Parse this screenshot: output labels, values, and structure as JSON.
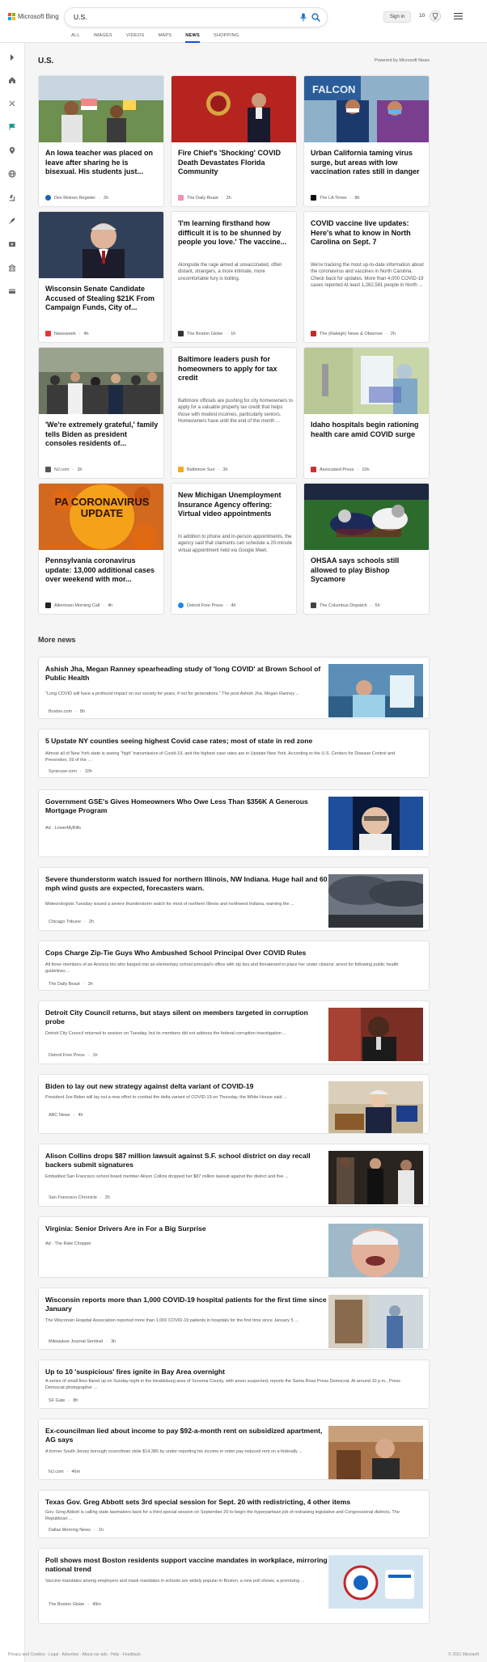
{
  "header": {
    "logo_text": "Microsoft Bing",
    "search_query": "U.S.",
    "signin_label": "Sign in",
    "points": "10",
    "tabs": [
      "ALL",
      "IMAGES",
      "VIDEOS",
      "MAPS",
      "NEWS",
      "SHOPPING"
    ],
    "active_tab": "NEWS",
    "logo_colors": [
      "#f25022",
      "#7fba00",
      "#00a4ef",
      "#ffb900"
    ]
  },
  "sidebar": {
    "icons": [
      "chevron-right-icon",
      "home-icon",
      "crossed-tools-icon",
      "flag-icon",
      "pin-icon",
      "globe-icon",
      "microscope-icon",
      "rocket-icon",
      "video-icon",
      "building-icon",
      "card-icon"
    ]
  },
  "section": {
    "title": "U.S.",
    "powered_by": "Powered by Microsoft News"
  },
  "cards": [
    {
      "title": "An Iowa teacher was placed on leave after sharing he is bisexual. His students just...",
      "source": "Des Moines Register",
      "time": "2h",
      "logo_color": "#1565c0"
    },
    {
      "title": "Fire Chief's 'Shocking' COVID Death Devastates Florida Community",
      "source": "The Daily Beast",
      "time": "2h",
      "logo_color": "#f48fb1"
    },
    {
      "title": "Urban California taming virus surge, but areas with low vaccination rates still in danger",
      "source": "The LA Times",
      "time": "8h",
      "logo_color": "#111111"
    },
    {
      "title": "Wisconsin Senate Candidate Accused of Stealing $21K From Campaign Funds, City of...",
      "source": "Newsweek",
      "time": "4h",
      "logo_color": "#e53935"
    },
    {
      "title": "'I'm learning firsthand how difficult it is to be shunned by people you love.' The vaccine...",
      "snippet": "Alongside the rage aimed at unvaccinated, often distant, strangers, a more intimate, more uncomfortable fury is boiling.",
      "source": "The Boston Globe",
      "time": "1h",
      "logo_color": "#333333"
    },
    {
      "title": "COVID vaccine live updates: Here's what to know in North Carolina on Sept. 7",
      "snippet": "We're tracking the most up-to-date information about the coronavirus and vaccines in North Carolina. Check back for updates. More than 4,000 COVID-19 cases reported At least 1,262,581 people in North ...",
      "source": "The (Raleigh) News & Observer",
      "time": "2h",
      "logo_color": "#c62828"
    },
    {
      "title": "'We're extremely grateful,' family tells Biden as president consoles residents of...",
      "source": "NJ.com",
      "time": "3h",
      "logo_color": "#555555"
    },
    {
      "title": "Baltimore leaders push for homeowners to apply for tax credit",
      "snippet": "Baltimore officials are pushing for city homeowners to apply for a valuable property tax credit that helps those with modest incomes, particularly seniors. Homeowners have until the end of the month ...",
      "source": "Baltimore Sun",
      "time": "3h",
      "logo_color": "#f9a825"
    },
    {
      "title": "Idaho hospitals begin rationing health care amid COVID surge",
      "source": "Associated Press",
      "time": "10h",
      "logo_color": "#d32f2f"
    },
    {
      "title": "Pennsylvania coronavirus update: 13,000 additional cases over weekend with mor...",
      "source": "Allentown Morning Call",
      "time": "4h",
      "logo_color": "#222222",
      "image_caption": "PA CORONAVIRUS UPDATE"
    },
    {
      "title": "New Michigan Unemployment Insurance Agency offering: Virtual video appointments",
      "snippet": "In addition to phone and in-person appointments, the agency said that claimants can schedule a 20-minute virtual appointment held via Google Meet.",
      "source": "Detroit Free Press",
      "time": "4h",
      "logo_color": "#1e88e5"
    },
    {
      "title": "OHSAA says schools still allowed to play Bishop Sycamore",
      "source": "The Columbus Dispatch",
      "time": "5h",
      "logo_color": "#444444"
    }
  ],
  "more_news_title": "More news",
  "rows": [
    {
      "title": "Ashish Jha, Megan Ranney spearheading study of 'long COVID' at Brown School of Public Health",
      "snippet": "\"Long COVID will have a profound impact on our society for years, if not for generations.\" The post Ashish Jha, Megan Ranney ...",
      "source": "Boston.com",
      "time": "8h",
      "logo_color": "#222"
    },
    {
      "title": "5 Upstate NY counties seeing highest Covid case rates; most of state in red zone",
      "snippet": "Almost all of New York state is seeing \"high\" transmission of Covid-19, and the highest case rates are in Upstate New York. According to the U.S. Centers for Disease Control and Prevention, 59 of the ...",
      "source": "Syracuse.com",
      "time": "10h",
      "logo_color": "#1976d2"
    },
    {
      "title": "Government GSE's Gives Homeowners Who Owe Less Than $356K A Generous Mortgage Program",
      "snippet": "",
      "source": "Ad · LowerMyBills",
      "time": "",
      "logo_color": ""
    },
    {
      "title": "Severe thunderstorm watch issued for northern Illinois, NW Indiana. Huge hail and 60 mph wind gusts are expected, forecasters warn.",
      "snippet": "Meteorologists Tuesday issued a severe thunderstorm watch for most of northern Illinois and northwest Indiana, warning the ...",
      "source": "Chicago Tribune",
      "time": "2h",
      "logo_color": "#1565c0"
    },
    {
      "title": "Cops Charge Zip-Tie Guys Who Ambushed School Principal Over COVID Rules",
      "snippet": "All three members of an Arizona trio who barged into an elementary school principal's office with zip ties and threatened to place her under citizens' arrest for following public health guidelines ...",
      "source": "The Daily Beast",
      "time": "3h",
      "logo_color": "#f48fb1"
    },
    {
      "title": "Detroit City Council returns, but stays silent on members targeted in corruption probe",
      "snippet": "Detroit City Council returned to session on Tuesday, but its members did not address the federal corruption investigation ...",
      "source": "Detroit Free Press",
      "time": "1h",
      "logo_color": "#1e88e5"
    },
    {
      "title": "Biden to lay out new strategy against delta variant of COVID-19",
      "snippet": "President Joe Biden will lay out a new effort to combat the delta variant of COVID-19 on Thursday, the White House said ...",
      "source": "ABC News",
      "time": "4h",
      "logo_color": "#333"
    },
    {
      "title": "Alison Collins drops $87 million lawsuit against S.F. school district on day recall backers submit signatures",
      "snippet": "Embattled San Francisco school board member Alison Collins dropped her $87 million lawsuit against the district and five ...",
      "source": "San Francisco Chronicle",
      "time": "2h",
      "logo_color": "#333"
    },
    {
      "title": "Virginia: Senior Drivers Are in For a Big Surprise",
      "snippet": "",
      "source": "Ad · The Rate Chopper",
      "time": "",
      "logo_color": ""
    },
    {
      "title": "Wisconsin reports more than 1,000 COVID-19 hospital patients for the first time since January",
      "snippet": "The Wisconsin Hospital Association reported more than 1,000 COVID-19 patients in hospitals for the first time since January 5 ...",
      "source": "Milwaukee Journal-Sentinel",
      "time": "3h",
      "logo_color": "#1565c0"
    },
    {
      "title": "Up to 10 'suspicious' fires ignite in Bay Area overnight",
      "snippet": "A series of small fires flared up on Sunday night in the Healdsburg area of Sonoma County, with arson suspected, reports the Santa Rosa Press Democrat. At around 10 p.m., Press Democrat photographer ...",
      "source": "SF Gate",
      "time": "8h",
      "logo_color": "#e53935"
    },
    {
      "title": "Ex-councilman lied about income to pay $92-a-month rent on subsidized apartment, AG says",
      "snippet": "A former South Jersey borough councilman stole $14,385 by under-reporting his income in order pay reduced rent on a federally ...",
      "source": "NJ.com",
      "time": "46m",
      "logo_color": "#555"
    },
    {
      "title": "Texas Gov. Greg Abbott sets 3rd special session for Sept. 20 with redistricting, 4 other items",
      "snippet": "Gov. Greg Abbott is calling state lawmakers back for a third special session on September 20 to begin the hyperpartisan job of redrawing legislative and Congressional districts. The Republican ...",
      "source": "Dallas Morning News",
      "time": "1h",
      "logo_color": "#1976d2"
    },
    {
      "title": "Poll shows most Boston residents support vaccine mandates in workplace, mirroring national trend",
      "snippet": "Vaccine mandates among employers and mask mandates in schools are widely popular in Boston, a new poll shows, a promising ...",
      "source": "The Boston Globe",
      "time": "49m",
      "logo_color": "#333"
    }
  ],
  "footer": {
    "left": "Privacy and Cookies · Legal · Advertise · About our ads · Help · Feedback",
    "right": "© 2021 Microsoft"
  }
}
